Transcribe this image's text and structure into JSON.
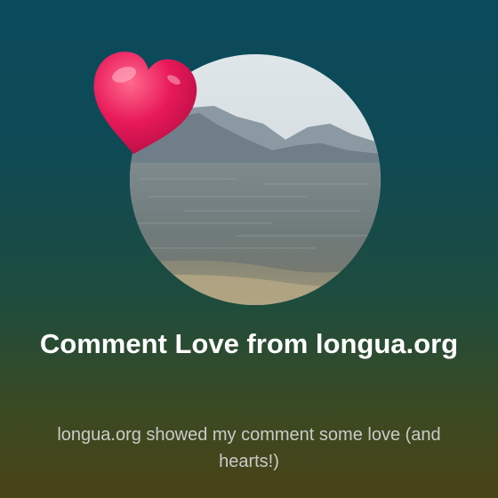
{
  "card": {
    "title": "Comment Love from longua.org",
    "subtitle": "longua.org showed my comment some love (and hearts!)"
  },
  "colors": {
    "background_top": "#0a4a5c",
    "background_bottom": "#4a4317",
    "heart": "#e8195a",
    "title_text": "#ffffff",
    "subtitle_text": "#c8ccca"
  },
  "icons": {
    "heart": "heart-icon"
  }
}
